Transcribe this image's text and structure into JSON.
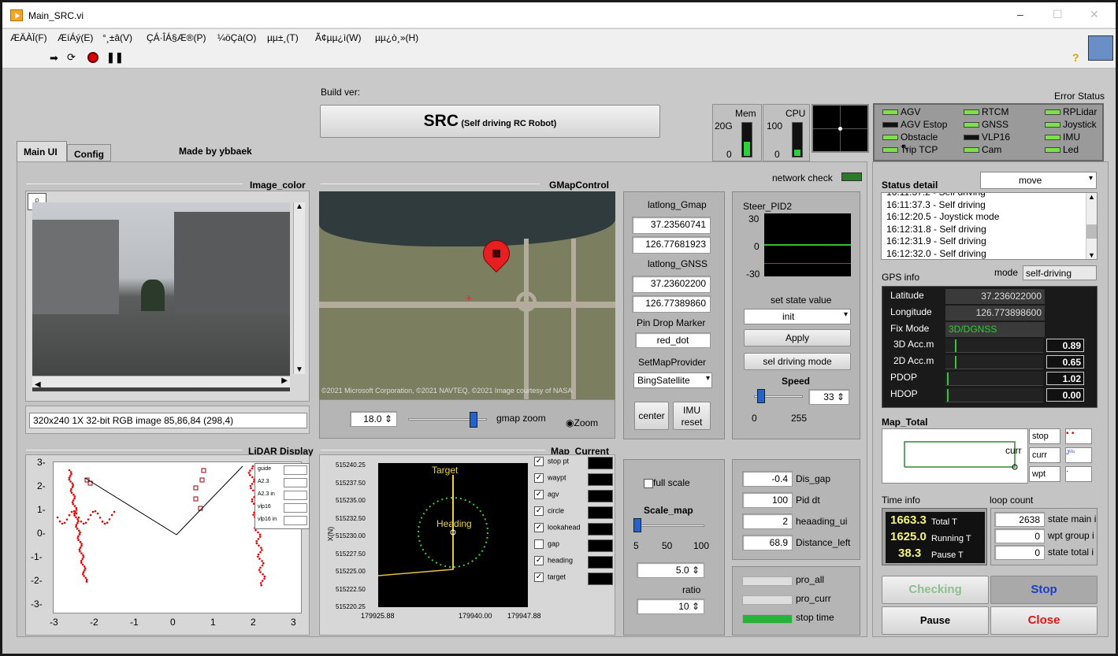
{
  "window": {
    "title": "Main_SRC.vi",
    "min": "–",
    "max": "☐",
    "close": "✕"
  },
  "menu": [
    "ÆÄÀÏ(F)",
    "ÆíÁý(E)",
    "°¸±â(V)",
    "ÇÁ·ÎÁ§Æ®(P)",
    "¼öÇà(O)",
    "µµ±¸(T)",
    "Ã¢µµ¿ì(W)",
    "µµ¿ò¸»(H)"
  ],
  "toolbar": {
    "help": "?"
  },
  "header": {
    "build_ver_label": "Build ver:",
    "title_big": "SRC",
    "title_small": "(Self driving RC Robot)",
    "made_by": "Made by ybbaek"
  },
  "tabs": [
    {
      "label": "Main UI",
      "active": true
    },
    {
      "label": "Config",
      "active": false
    }
  ],
  "mem": {
    "label": "Mem",
    "scale_top": "20G",
    "scale_bottom": "0",
    "level": 0.45
  },
  "cpu": {
    "label": "CPU",
    "scale_top": "100",
    "scale_bottom": "0",
    "level": 0.2
  },
  "error_status": {
    "label": "Error Status",
    "items": [
      {
        "name": "AGV",
        "on": true
      },
      {
        "name": "RTCM",
        "on": true
      },
      {
        "name": "RPLidar",
        "on": true
      },
      {
        "name": "AGV Estop",
        "on": false
      },
      {
        "name": "GNSS",
        "on": true
      },
      {
        "name": "Joystick",
        "on": true
      },
      {
        "name": "Obstacle",
        "on": true
      },
      {
        "name": "VLP16",
        "on": false
      },
      {
        "name": "IMU",
        "on": true
      },
      {
        "name": "Trip TCP",
        "on": true
      },
      {
        "name": "Cam",
        "on": true
      },
      {
        "name": "Led",
        "on": true
      }
    ]
  },
  "image_color": {
    "label": "Image_color",
    "info": "320x240 1X 32-bit RGB image 85,86,84    (298,4)"
  },
  "gmap": {
    "label": "GMapControl",
    "copyright": "©2021 Microsoft Corporation, ©2021 NAVTEQ, ©2021 Image courtesy of NASA",
    "zoom_value": "18.0",
    "zoom_label": "gmap zoom",
    "zoom_radio": "Zoom",
    "zoom_level": 0.82
  },
  "latlong": {
    "gmap_label": "latlong_Gmap",
    "gmap_lat": "37.23560741",
    "gmap_lon": "126.77681923",
    "gnss_label": "latlong_GNSS",
    "gnss_lat": "37.23602200",
    "gnss_lon": "126.77389860",
    "pin_label": "Pin Drop Marker",
    "pin_value": "red_dot",
    "provider_label": "SetMapProvider",
    "provider_value": "BingSatellite",
    "center": "center",
    "imu_reset": "IMU reset"
  },
  "network": {
    "label": "network check"
  },
  "steer": {
    "label": "Steer_PID2",
    "y_top": "30",
    "y_mid": "0",
    "y_bot": "-30",
    "state_label": "set state value",
    "state_value": "init",
    "apply": "Apply",
    "sel_mode": "sel driving mode",
    "speed_label": "Speed",
    "speed_value": "33",
    "speed_min": "0",
    "speed_max": "255",
    "speed_level": 0.13
  },
  "status": {
    "label": "Status detail",
    "dropdown": "move",
    "lines": [
      "16:11:37.3 - Self driving",
      "16:12:20.5 - Joystick mode",
      "16:12:31.8 - Self driving",
      "16:12:31.9 - Self driving",
      "16:12:32.0 - Self driving"
    ],
    "partial_line": "16:11:37.2 - Self driving"
  },
  "gps": {
    "label": "GPS info",
    "mode_label": "mode",
    "mode_value": "self-driving",
    "rows": [
      {
        "k": "Latitude",
        "v": "37.236022000"
      },
      {
        "k": "Longitude",
        "v": "126.773898600"
      },
      {
        "k": "Fix Mode",
        "v": "3D/DGNSS"
      }
    ],
    "bars": [
      {
        "k": "3D Acc.m",
        "v": "0.89"
      },
      {
        "k": "2D Acc.m",
        "v": "0.65"
      },
      {
        "k": "PDOP",
        "v": "1.02"
      },
      {
        "k": "HDOP",
        "v": "0.00"
      }
    ]
  },
  "map_total": {
    "label": "Map_Total",
    "curr_text": "curr",
    "legend": [
      "stop",
      "curr",
      "wpt"
    ]
  },
  "time_info": {
    "label": "Time info",
    "rows": [
      {
        "v": "1663.3",
        "k": "Total T"
      },
      {
        "v": "1625.0",
        "k": "Running T"
      },
      {
        "v": "38.3",
        "k": "Pause T"
      }
    ]
  },
  "loop": {
    "label": "loop count",
    "rows": [
      {
        "v": "2638",
        "k": "state main i"
      },
      {
        "v": "0",
        "k": "wpt group i"
      },
      {
        "v": "0",
        "k": "state total i"
      }
    ]
  },
  "buttons": {
    "checking": "Checking",
    "stop": "Stop",
    "pause": "Pause",
    "close": "Close"
  },
  "lidar": {
    "label": "LiDAR Display",
    "legend": [
      "guide",
      "A2.3",
      "A2.3 in",
      "vlp16",
      "vlp16 in"
    ],
    "yticks": [
      "3-",
      "2-",
      "1-",
      "0-",
      "-1-",
      "-2-",
      "-3-"
    ],
    "xticks": [
      "-3",
      "-2",
      "-1",
      "0",
      "1",
      "2",
      "3"
    ]
  },
  "map_current": {
    "label": "Map_Current",
    "target": "Target",
    "heading": "Heading",
    "ylabel": "X(N)",
    "yticks": [
      "515240.25",
      "515237.50",
      "515235.00",
      "515232.50",
      "515230.00",
      "515227.50",
      "515225.00",
      "515222.50",
      "515220.25"
    ],
    "xticks": [
      "179925.88",
      "179940.00",
      "179947.88"
    ],
    "legend": [
      {
        "k": "stop pt",
        "on": true
      },
      {
        "k": "waypt",
        "on": true
      },
      {
        "k": "agv",
        "on": true
      },
      {
        "k": "circle",
        "on": true
      },
      {
        "k": "lookahead",
        "on": true
      },
      {
        "k": "gap",
        "on": false
      },
      {
        "k": "heading",
        "on": true
      },
      {
        "k": "target",
        "on": true
      }
    ]
  },
  "scale": {
    "full_scale": "full scale",
    "label": "Scale_map",
    "ticks": [
      "5",
      "50",
      "100"
    ],
    "value": "5.0",
    "ratio_label": "ratio",
    "ratio": "10"
  },
  "dist": {
    "rows": [
      {
        "v": "-0.4",
        "k": "Dis_gap"
      },
      {
        "v": "100",
        "k": "Pid dt"
      },
      {
        "v": "2",
        "k": "heaading_ui"
      },
      {
        "v": "68.9",
        "k": "Distance_left"
      }
    ]
  },
  "progress": {
    "rows": [
      {
        "k": "pro_all",
        "level": 0
      },
      {
        "k": "pro_curr",
        "level": 0
      },
      {
        "k": "stop time",
        "level": 1
      }
    ]
  }
}
